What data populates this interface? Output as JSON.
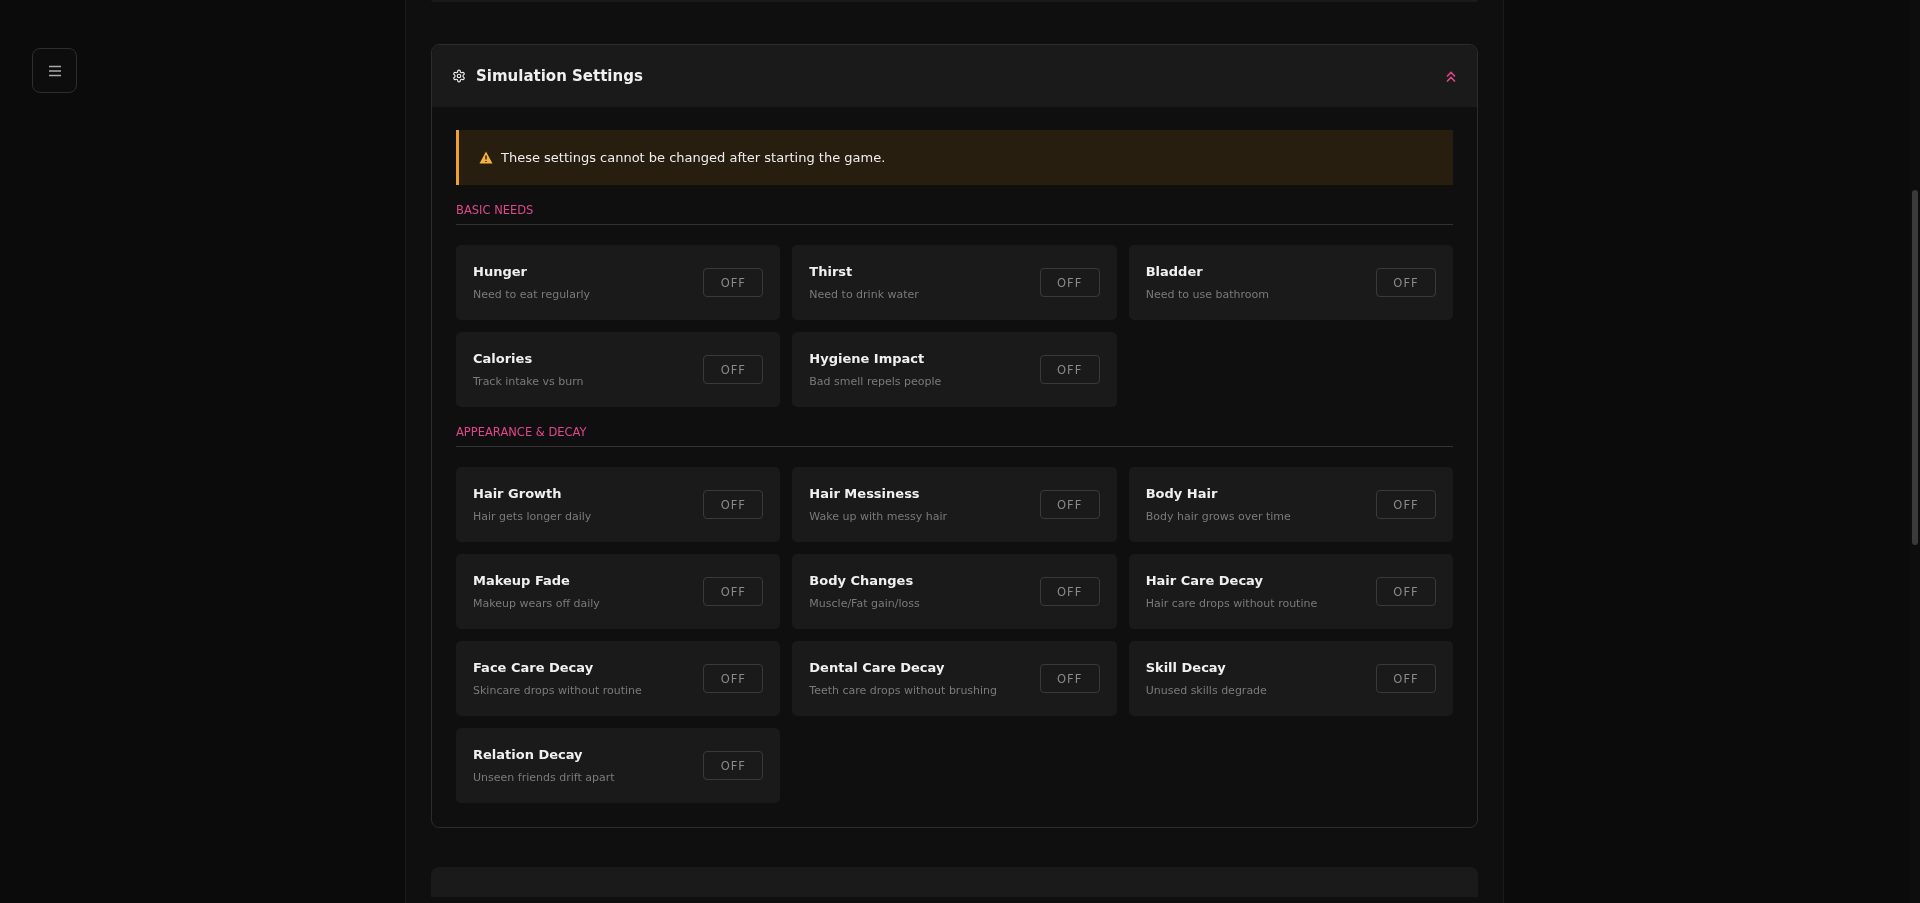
{
  "panel": {
    "title": "Simulation Settings",
    "expanded": true
  },
  "warning": "These settings cannot be changed after starting the game.",
  "sections": [
    {
      "title": "BASIC NEEDS",
      "settings": [
        {
          "name": "Hunger",
          "description": "Need to eat regularly",
          "toggle": "OFF",
          "on": false
        },
        {
          "name": "Thirst",
          "description": "Need to drink water",
          "toggle": "OFF",
          "on": false
        },
        {
          "name": "Bladder",
          "description": "Need to use bathroom",
          "toggle": "OFF",
          "on": false
        },
        {
          "name": "Calories",
          "description": "Track intake vs burn",
          "toggle": "OFF",
          "on": false
        },
        {
          "name": "Hygiene Impact",
          "description": "Bad smell repels people",
          "toggle": "OFF",
          "on": false
        }
      ]
    },
    {
      "title": "APPEARANCE & DECAY",
      "settings": [
        {
          "name": "Hair Growth",
          "description": "Hair gets longer daily",
          "toggle": "OFF",
          "on": false
        },
        {
          "name": "Hair Messiness",
          "description": "Wake up with messy hair",
          "toggle": "OFF",
          "on": false
        },
        {
          "name": "Body Hair",
          "description": "Body hair grows over time",
          "toggle": "OFF",
          "on": false
        },
        {
          "name": "Makeup Fade",
          "description": "Makeup wears off daily",
          "toggle": "OFF",
          "on": false
        },
        {
          "name": "Body Changes",
          "description": "Muscle/Fat gain/loss",
          "toggle": "OFF",
          "on": false
        },
        {
          "name": "Hair Care Decay",
          "description": "Hair care drops without routine",
          "toggle": "OFF",
          "on": false
        },
        {
          "name": "Face Care Decay",
          "description": "Skincare drops without routine",
          "toggle": "OFF",
          "on": false
        },
        {
          "name": "Dental Care Decay",
          "description": "Teeth care drops without brushing",
          "toggle": "OFF",
          "on": false
        },
        {
          "name": "Skill Decay",
          "description": "Unused skills degrade",
          "toggle": "OFF",
          "on": false
        },
        {
          "name": "Relation Decay",
          "description": "Unseen friends drift apart",
          "toggle": "OFF",
          "on": false
        }
      ]
    }
  ]
}
